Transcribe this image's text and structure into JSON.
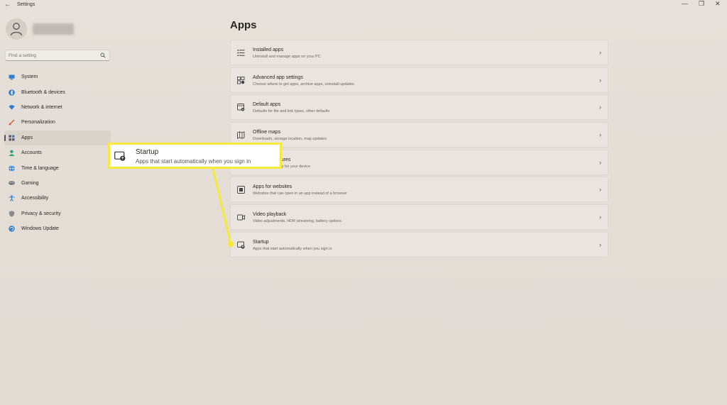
{
  "window": {
    "title": "Settings",
    "back_glyph": "←",
    "minimize_glyph": "—",
    "restore_glyph": "❐",
    "close_glyph": "✕"
  },
  "search": {
    "placeholder": "Find a setting",
    "icon": "search-icon"
  },
  "sidebar": {
    "items": [
      {
        "label": "System",
        "icon": "system-icon",
        "color": "#2f7fd1"
      },
      {
        "label": "Bluetooth & devices",
        "icon": "bluetooth-icon",
        "color": "#2f7fd1"
      },
      {
        "label": "Network & internet",
        "icon": "wifi-icon",
        "color": "#2f7fd1"
      },
      {
        "label": "Personalization",
        "icon": "brush-icon",
        "color": "#c9733a"
      },
      {
        "label": "Apps",
        "icon": "apps-icon",
        "color": "#555a70",
        "active": true
      },
      {
        "label": "Accounts",
        "icon": "person-icon",
        "color": "#2aa37a"
      },
      {
        "label": "Time & language",
        "icon": "globe-icon",
        "color": "#2f7fd1"
      },
      {
        "label": "Gaming",
        "icon": "gamepad-icon",
        "color": "#6a6f7a"
      },
      {
        "label": "Accessibility",
        "icon": "accessibility-icon",
        "color": "#2f7fd1"
      },
      {
        "label": "Privacy & security",
        "icon": "shield-icon",
        "color": "#777777"
      },
      {
        "label": "Windows Update",
        "icon": "update-icon",
        "color": "#2f7fd1"
      }
    ]
  },
  "main": {
    "title": "Apps",
    "rows": [
      {
        "title": "Installed apps",
        "subtitle": "Uninstall and manage apps on your PC",
        "icon": "list-icon"
      },
      {
        "title": "Advanced app settings",
        "subtitle": "Choose where to get apps, archive apps, uninstall updates",
        "icon": "app-settings-icon"
      },
      {
        "title": "Default apps",
        "subtitle": "Defaults for file and link types, other defaults",
        "icon": "default-apps-icon"
      },
      {
        "title": "Offline maps",
        "subtitle": "Downloads, storage location, map updates",
        "icon": "map-icon"
      },
      {
        "title": "Optional features",
        "subtitle": "Extra functionality for your device",
        "icon": "optional-features-icon"
      },
      {
        "title": "Apps for websites",
        "subtitle": "Websites that can open in an app instead of a browser",
        "icon": "web-apps-icon"
      },
      {
        "title": "Video playback",
        "subtitle": "Video adjustments, HDR streaming, battery options",
        "icon": "video-icon"
      },
      {
        "title": "Startup",
        "subtitle": "Apps that start automatically when you sign in",
        "icon": "startup-icon"
      }
    ],
    "chevron": "›"
  },
  "callout": {
    "title": "Startup",
    "subtitle": "Apps that start automatically when you sign in",
    "icon": "startup-icon",
    "border_color": "#f5e93a"
  }
}
